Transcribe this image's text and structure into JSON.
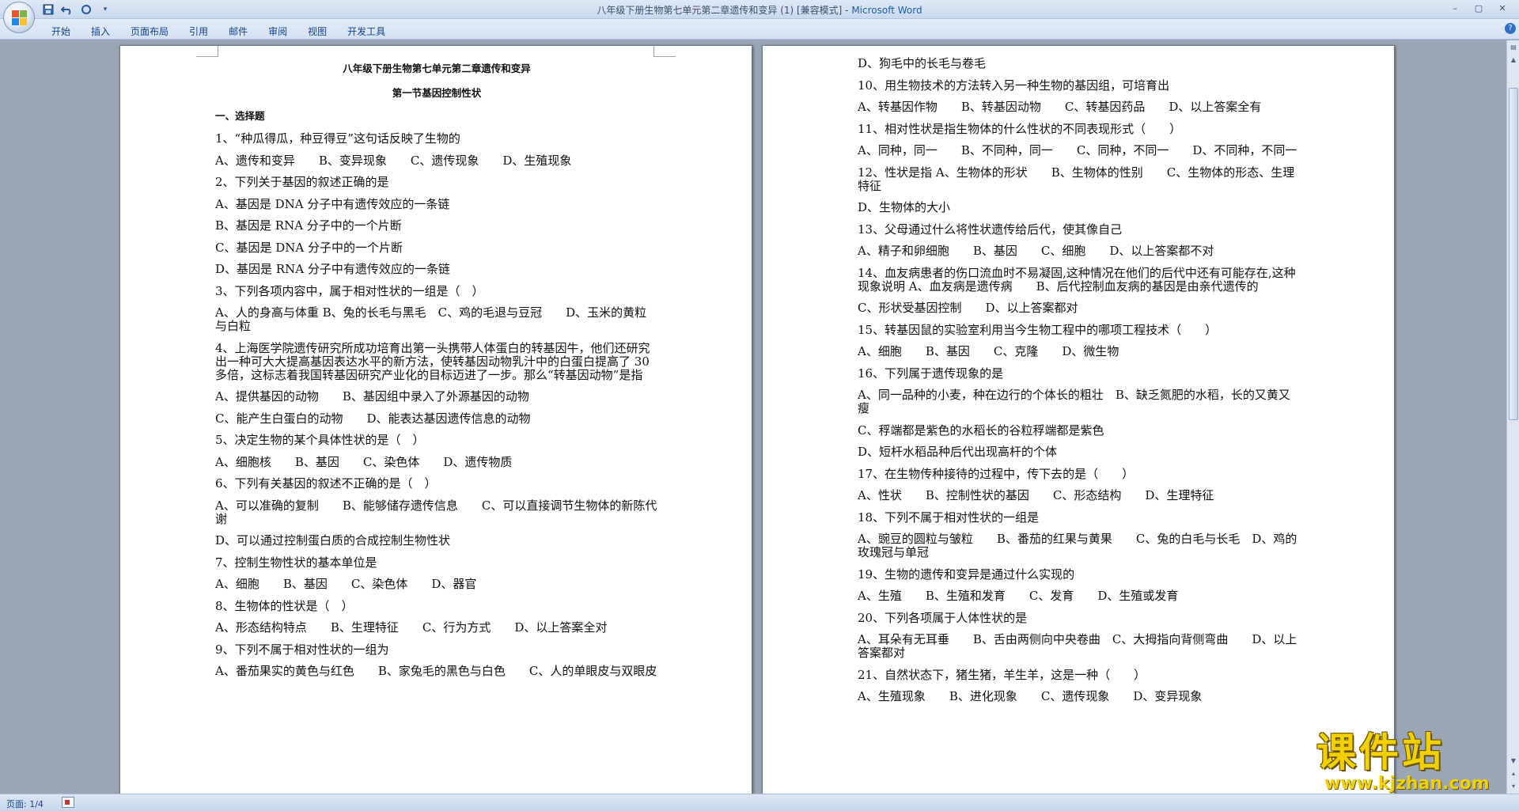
{
  "window": {
    "title": "八年级下册生物第七单元第二章遗传和变异 (1) [兼容模式] - ",
    "app_name": "Microsoft Word",
    "controls": [
      "–",
      "▢",
      "✕"
    ]
  },
  "quick_access": [
    "save-icon",
    "undo-icon",
    "redo-icon"
  ],
  "ribbon": {
    "tabs": [
      "开始",
      "插入",
      "页面布局",
      "引用",
      "邮件",
      "审阅",
      "视图",
      "开发工具"
    ]
  },
  "page_left": [
    {
      "cls": "h1",
      "text": "八年级下册生物第七单元第二章遗传和变异"
    },
    {
      "cls": "h2",
      "text": "第一节基因控制性状"
    },
    {
      "cls": "h3",
      "text": "一、选择题"
    },
    {
      "cls": "",
      "text": "1、“种瓜得瓜，种豆得豆”这句话反映了生物的"
    },
    {
      "cls": "",
      "text": "A、遗传和变异　　B、变异现象　　C、遗传现象　　D、生殖现象"
    },
    {
      "cls": "",
      "text": "2、下列关于基因的叙述正确的是"
    },
    {
      "cls": "",
      "text": "A、基因是 DNA 分子中有遗传效应的一条链"
    },
    {
      "cls": "",
      "text": "B、基因是 RNA 分子中的一个片断"
    },
    {
      "cls": "",
      "text": "C、基因是 DNA 分子中的一个片断"
    },
    {
      "cls": "",
      "text": "D、基因是 RNA 分子中有遗传效应的一条链"
    },
    {
      "cls": "",
      "text": "3、下列各项内容中，属于相对性状的一组是（　）"
    },
    {
      "cls": "",
      "text": "A、人的身高与体重 B、兔的长毛与黑毛　C、鸡的毛退与豆冠　　D、玉米的黄粒与白粒"
    },
    {
      "cls": "",
      "text": "4、上海医学院遗传研究所成功培育出第一头携带人体蛋白的转基因牛，他们还研究出一种可大大提高基因表达水平的新方法，使转基因动物乳汁中的白蛋白提高了 30 多倍，这标志着我国转基因研究产业化的目标迈进了一步。那么“转基因动物”是指"
    },
    {
      "cls": "",
      "text": "A、提供基因的动物　　B、基因组中录入了外源基因的动物"
    },
    {
      "cls": "",
      "text": "C、能产生白蛋白的动物　　D、能表达基因遗传信息的动物"
    },
    {
      "cls": "",
      "text": "5、决定生物的某个具体性状的是（　）"
    },
    {
      "cls": "",
      "text": "A、细胞核　　B、基因　　C、染色体　　D、遗传物质"
    },
    {
      "cls": "",
      "text": "6、下列有关基因的叙述不正确的是（　）"
    },
    {
      "cls": "",
      "text": "A、可以准确的复制　　B、能够储存遗传信息　　C、可以直接调节生物体的新陈代谢"
    },
    {
      "cls": "",
      "text": "D、可以通过控制蛋白质的合成控制生物性状"
    },
    {
      "cls": "",
      "text": "7、控制生物性状的基本单位是"
    },
    {
      "cls": "",
      "text": "A、细胞　　B、基因　　C、染色体　　D、器官"
    },
    {
      "cls": "",
      "text": "8、生物体的性状是（　）"
    },
    {
      "cls": "",
      "text": "A、形态结构特点　　B、生理特征　　C、行为方式　　D、以上答案全对"
    },
    {
      "cls": "",
      "text": "9、下列不属于相对性状的一组为"
    },
    {
      "cls": "",
      "text": "A、番茄果实的黄色与红色　　B、家兔毛的黑色与白色　　C、人的单眼皮与双眼皮"
    }
  ],
  "page_right": [
    {
      "cls": "",
      "text": "D、狗毛中的长毛与卷毛"
    },
    {
      "cls": "",
      "text": "10、用生物技术的方法转入另一种生物的基因组，可培育出"
    },
    {
      "cls": "",
      "text": "A、转基因作物　　B、转基因动物　　C、转基因药品　　D、以上答案全有"
    },
    {
      "cls": "",
      "text": "11、相对性状是指生物体的什么性状的不同表现形式（　　）"
    },
    {
      "cls": "",
      "text": "A、同种，同一　　B、不同种，同一　　C、同种，不同一　　D、不同种，不同一"
    },
    {
      "cls": "",
      "text": "12、性状是指 A、生物体的形状　　B、生物体的性别　　C、生物体的形态、生理特征"
    },
    {
      "cls": "",
      "text": "D、生物体的大小"
    },
    {
      "cls": "",
      "text": "13、父母通过什么将性状遗传给后代，使其像自己"
    },
    {
      "cls": "",
      "text": "A、精子和卵细胞　　B、基因　　C、细胞　　D、以上答案都不对"
    },
    {
      "cls": "",
      "text": "14、血友病患者的伤口流血时不易凝固,这种情况在他们的后代中还有可能存在,这种现象说明 A、血友病是遗传病　　B、后代控制血友病的基因是由亲代遗传的"
    },
    {
      "cls": "",
      "text": "C、形状受基因控制　　D、以上答案都对"
    },
    {
      "cls": "",
      "text": "15、转基因鼠的实验室利用当今生物工程中的哪项工程技术（　　）"
    },
    {
      "cls": "",
      "text": "A、细胞　　B、基因　　C、克隆　　D、微生物"
    },
    {
      "cls": "",
      "text": "16、下列属于遗传现象的是"
    },
    {
      "cls": "",
      "text": "A、同一品种的小麦，种在边行的个体长的粗壮　B、缺乏氮肥的水稻，长的又黄又瘦"
    },
    {
      "cls": "",
      "text": "C、稃端都是紫色的水稻长的谷粒稃端都是紫色"
    },
    {
      "cls": "",
      "text": "D、短杆水稻品种后代出现高杆的个体"
    },
    {
      "cls": "",
      "text": "17、在生物传种接待的过程中，传下去的是（　　）"
    },
    {
      "cls": "",
      "text": "A、性状　　B、控制性状的基因　　C、形态结构　　D、生理特征"
    },
    {
      "cls": "",
      "text": "18、下列不属于相对性状的一组是"
    },
    {
      "cls": "",
      "text": "A、豌豆的圆粒与皱粒　　B、番茄的红果与黄果　　C、兔的白毛与长毛　D、鸡的玫瑰冠与单冠"
    },
    {
      "cls": "",
      "text": "19、生物的遗传和变异是通过什么实现的"
    },
    {
      "cls": "",
      "text": "A、生殖　　B、生殖和发育　　C、发育　　D、生殖或发育"
    },
    {
      "cls": "",
      "text": "20、下列各项属于人体性状的是"
    },
    {
      "cls": "",
      "text": "A、耳朵有无耳垂　　B、舌由两侧向中央卷曲　C、大拇指向背侧弯曲　　D、以上答案都对"
    },
    {
      "cls": "",
      "text": "21、自然状态下，猪生猪，羊生羊，这是一种（　　）"
    },
    {
      "cls": "",
      "text": "A、生殖现象　　B、进化现象　　C、遗传现象　　D、变异现象"
    }
  ],
  "status": {
    "page_label": "页面: 1/4"
  },
  "watermark": {
    "title": "课件站",
    "url": "www.kjzhan.com"
  },
  "colors": {
    "office_logo": [
      "#e8572a",
      "#7cb342",
      "#1e88e5",
      "#fbc02d"
    ],
    "watermark": "#f1d200"
  }
}
